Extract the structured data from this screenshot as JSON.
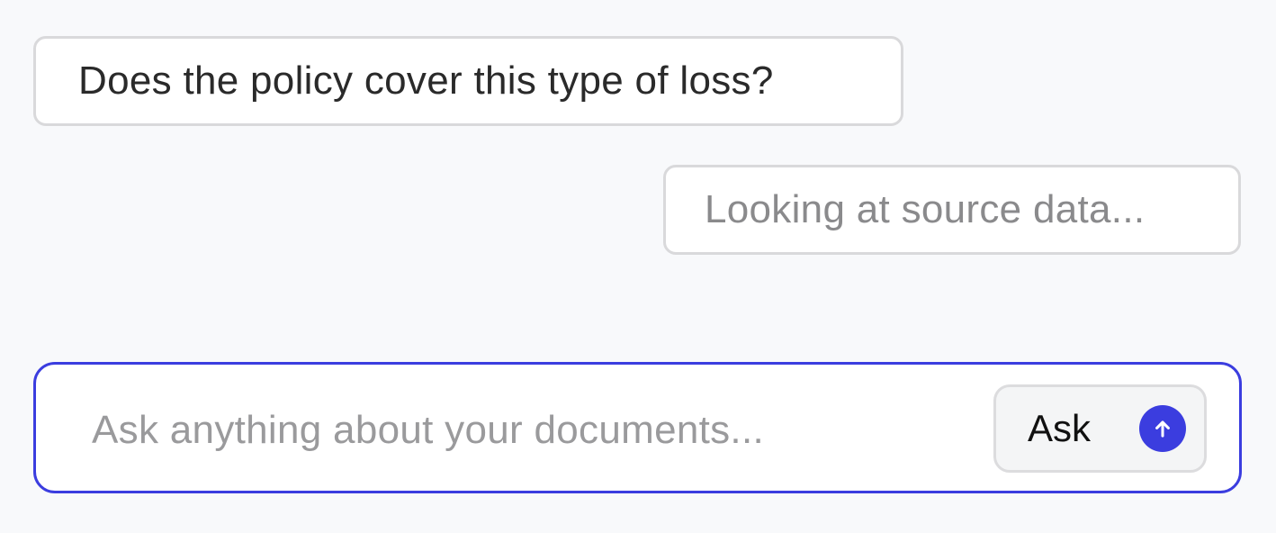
{
  "conversation": {
    "user_message": "Does the policy cover this type of loss?",
    "assistant_status": "Looking at source data..."
  },
  "composer": {
    "placeholder": "Ask anything about your documents...",
    "value": "",
    "ask_label": "Ask"
  },
  "icons": {
    "send": "arrow-up-icon"
  },
  "colors": {
    "accent": "#3b3ddf",
    "background": "#f8f9fb",
    "bubble_border": "#d9d9db",
    "placeholder_text": "#9a9a9c",
    "status_text": "#8a8a8c"
  }
}
